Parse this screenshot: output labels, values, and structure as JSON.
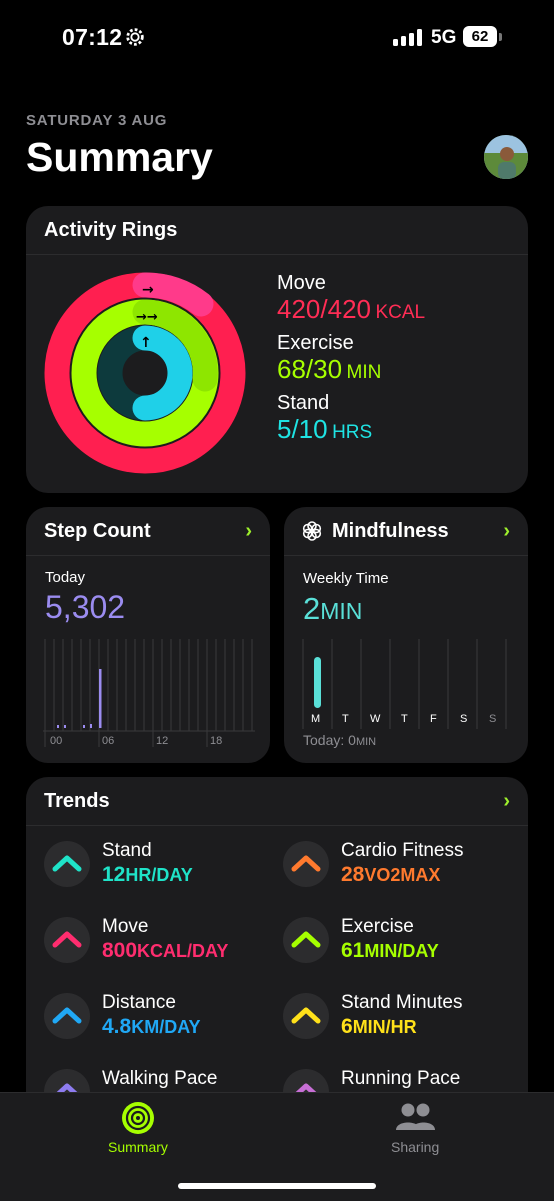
{
  "status_bar": {
    "time": "07:12",
    "network": "5G",
    "battery": "62"
  },
  "header": {
    "date": "SATURDAY 3 AUG",
    "title": "Summary"
  },
  "activity": {
    "title": "Activity Rings",
    "move": {
      "label": "Move",
      "value": "420/420",
      "unit": "KCAL",
      "color": "#ff2d55",
      "progress": 1.0
    },
    "exercise": {
      "label": "Exercise",
      "value": "68/30",
      "unit": "MIN",
      "color": "#a6ff00",
      "progress": 2.27
    },
    "stand": {
      "label": "Stand",
      "value": "5/10",
      "unit": "HRS",
      "color": "#1fe3e3",
      "progress": 0.5
    }
  },
  "steps": {
    "title": "Step Count",
    "period": "Today",
    "value": "5,302",
    "x_ticks": [
      "00",
      "06",
      "12",
      "18"
    ],
    "color": "#9b8cf0"
  },
  "mindfulness": {
    "title": "Mindfulness",
    "period": "Weekly Time",
    "value": "2",
    "unit": "MIN",
    "days": [
      "M",
      "T",
      "W",
      "T",
      "F",
      "S",
      "S"
    ],
    "today_label": "Today: 0",
    "today_unit": "MIN",
    "color": "#5ae0d8"
  },
  "trends": {
    "title": "Trends",
    "items": [
      {
        "name": "Stand",
        "value": "12",
        "unit": "HR/DAY",
        "color": "#1fe3c8"
      },
      {
        "name": "Cardio Fitness",
        "value": "28",
        "unit": "VO2MAX",
        "color": "#ff7a2e"
      },
      {
        "name": "Move",
        "value": "800",
        "unit": "KCAL/DAY",
        "color": "#ff2d6f"
      },
      {
        "name": "Exercise",
        "value": "61",
        "unit": "MIN/DAY",
        "color": "#a6ff00"
      },
      {
        "name": "Distance",
        "value": "4.8",
        "unit": "KM/DAY",
        "color": "#20a8f5"
      },
      {
        "name": "Stand Minutes",
        "value": "6",
        "unit": "MIN/HR",
        "color": "#ffe11a"
      },
      {
        "name": "Walking Pace",
        "value": "",
        "unit": "",
        "color": "#8e7cf0"
      },
      {
        "name": "Running Pace",
        "value": "",
        "unit": "",
        "color": "#c86fd6"
      }
    ]
  },
  "tabs": [
    {
      "label": "Summary",
      "color": "#a6ff00"
    },
    {
      "label": "Sharing",
      "color": "#8e8e93"
    }
  ]
}
